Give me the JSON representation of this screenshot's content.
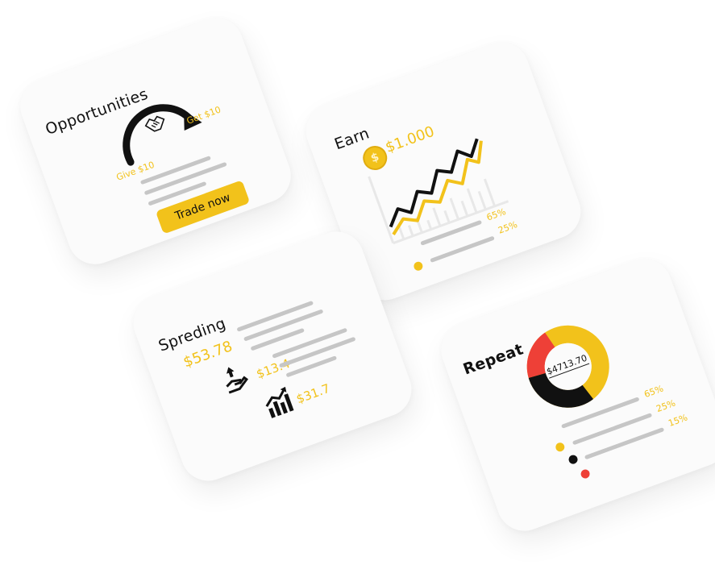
{
  "opportunities": {
    "title": "Opportunities",
    "give_label": "Give $10",
    "get_label": "Get $10",
    "button_label": "Trade now"
  },
  "earn": {
    "title": "Earn",
    "amount": "$1.000",
    "bars": [
      {
        "percent": "65%"
      },
      {
        "percent": "25%"
      }
    ]
  },
  "spending": {
    "title": "Spreding",
    "total": "$53.78",
    "items": [
      {
        "icon": "hand-money-up-icon",
        "amount": "$13.4"
      },
      {
        "icon": "growth-chart-icon",
        "amount": "$31.7"
      }
    ]
  },
  "repeat": {
    "title": "Repeat",
    "donut_center": "$4713.70",
    "segments": [
      {
        "percent": "65%",
        "color": "#f2c21b"
      },
      {
        "percent": "25%",
        "color": "#111111"
      },
      {
        "percent": "15%",
        "color": "#ee4037"
      }
    ]
  },
  "colors": {
    "accent": "#f2c21b",
    "dark": "#111111",
    "red": "#ee4037",
    "grey": "#c6c6c6"
  }
}
